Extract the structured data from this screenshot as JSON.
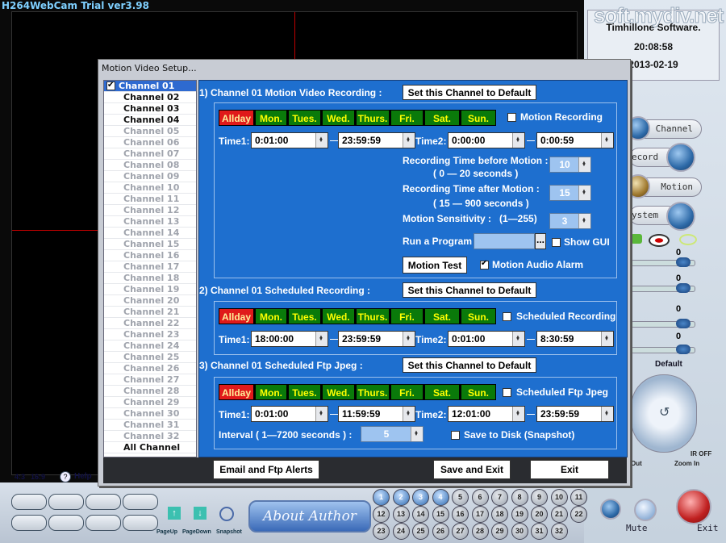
{
  "app": {
    "title": "H264WebCam Trial ver3.98"
  },
  "clock": {
    "company": "Timhillone Software.",
    "time": "20:08:58",
    "date": "2013-02-19",
    "watermark": "soft.mydiv.net"
  },
  "right_panel": {
    "channel_label": "Channel",
    "record_label": "ecord",
    "motion_label": "Motion",
    "system_label": "ystem",
    "slider_values": [
      "0",
      "0",
      "0",
      "0"
    ],
    "default_label": "Default",
    "ir_off": "IR OFF",
    "zoom_in": "Zoom In",
    "zoom_out": "Out",
    "mute": "Mute",
    "exit": "Exit"
  },
  "bottom_bar": {
    "aspect_43": "4:3",
    "aspect_169": "16:9",
    "help": "Help",
    "help_icon": "?",
    "about_author": "About Author",
    "pageup": "PageUp",
    "pagedown": "PageDown",
    "snapshot": "Snapshot",
    "channel_numbers": [
      "1",
      "2",
      "3",
      "4",
      "5",
      "6",
      "7",
      "8",
      "9",
      "10",
      "11",
      "12",
      "13",
      "14",
      "15",
      "16",
      "17",
      "18",
      "19",
      "20",
      "21",
      "22",
      "23",
      "24",
      "25",
      "26",
      "27",
      "28",
      "29",
      "30",
      "31",
      "32"
    ]
  },
  "dialog": {
    "title": "Motion Video Setup...",
    "channels": [
      "Channel 01",
      "Channel 02",
      "Channel 03",
      "Channel 04",
      "Channel 05",
      "Channel 06",
      "Channel 07",
      "Channel 08",
      "Channel 09",
      "Channel 10",
      "Channel 11",
      "Channel 12",
      "Channel 13",
      "Channel 14",
      "Channel 15",
      "Channel 16",
      "Channel 17",
      "Channel 18",
      "Channel 19",
      "Channel 20",
      "Channel 21",
      "Channel 22",
      "Channel 23",
      "Channel 24",
      "Channel 25",
      "Channel 26",
      "Channel 27",
      "Channel 28",
      "Channel 29",
      "Channel 30",
      "Channel 31",
      "Channel 32"
    ],
    "all_channel": "All Channel",
    "days": [
      "Allday",
      "Mon.",
      "Tues.",
      "Wed.",
      "Thurs.",
      "Fri.",
      "Sat.",
      "Sun."
    ],
    "set_default": "Set this Channel to Default",
    "section1": {
      "title": "1)  Channel 01 Motion Video Recording :",
      "checkbox": "Motion Recording",
      "time1_label": "Time1:",
      "time1_start": "0:01:00",
      "time1_end": "23:59:59",
      "time2_label": "Time2:",
      "time2_start": "0:00:00",
      "time2_end": "0:00:59",
      "image_label": "image",
      "before_label": "Recording Time before Motion :",
      "before_range": "( 0 — 20 seconds )",
      "before_value": "10",
      "after_label": "Recording Time after Motion :",
      "after_range": "( 15 — 900 seconds )",
      "after_value": "15",
      "sensitivity_label": "Motion Sensitivity :",
      "sensitivity_range": "(1—255)",
      "sensitivity_value": "3",
      "run_program_label": "Run a Program",
      "browse": "...",
      "show_gui": "Show GUI",
      "motion_test": "Motion Test",
      "audio_alarm": "Motion Audio Alarm"
    },
    "section2": {
      "title": "2)  Channel 01 Scheduled Recording :",
      "checkbox": "Scheduled Recording",
      "time1_label": "Time1:",
      "time1_start": "18:00:00",
      "time1_end": "23:59:59",
      "time2_label": "Time2:",
      "time2_start": "0:01:00",
      "time2_end": "8:30:59"
    },
    "section3": {
      "title": "3)  Channel 01 Scheduled Ftp Jpeg :",
      "checkbox": "Scheduled Ftp Jpeg",
      "time1_label": "Time1:",
      "time1_start": "0:01:00",
      "time1_end": "11:59:59",
      "time2_label": "Time2:",
      "time2_start": "12:01:00",
      "time2_end": "23:59:59",
      "interval_label": "Interval ( 1—7200 seconds ) :",
      "interval_value": "5",
      "save_disk": "Save to Disk  (Snapshot)"
    },
    "buttons": {
      "email": "Email and Ftp Alerts",
      "save_exit": "Save and Exit",
      "exit": "Exit"
    }
  }
}
